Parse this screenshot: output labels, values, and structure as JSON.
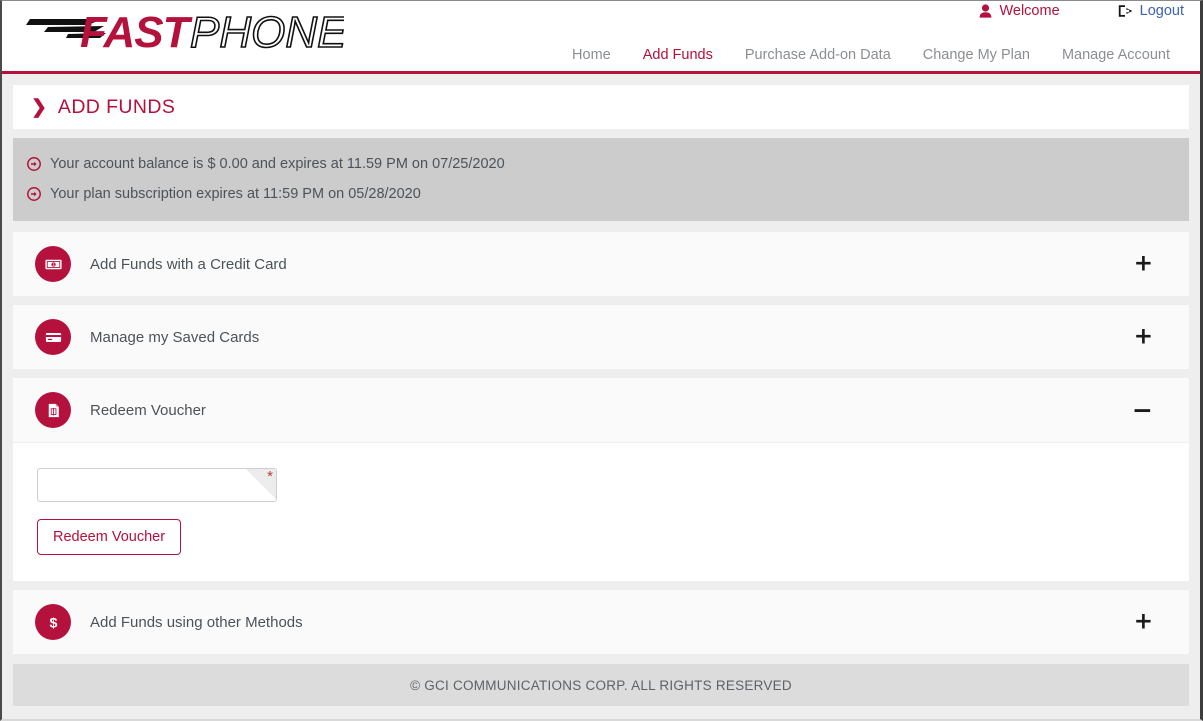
{
  "brand": {
    "logo_primary": "FAST",
    "logo_secondary": "PHONE",
    "accent_color": "#b4113c",
    "link_color": "#3b63b0"
  },
  "header": {
    "account_links": [
      {
        "label": "Welcome",
        "icon": "user-icon",
        "color": "#b4113c"
      },
      {
        "label": "Logout",
        "icon": "logout-icon",
        "color": "#3b63b0"
      }
    ],
    "nav": [
      {
        "label": "Home",
        "active": false
      },
      {
        "label": "Add Funds",
        "active": true
      },
      {
        "label": "Purchase Add-on Data",
        "active": false
      },
      {
        "label": "Change My Plan",
        "active": false
      },
      {
        "label": "Manage Account",
        "active": false
      }
    ]
  },
  "page": {
    "title": "ADD FUNDS",
    "title_icon": "chevron-right-icon",
    "notices": [
      {
        "icon": "arrow-circle-right-icon",
        "text": "Your account balance is $ 0.00 and expires at 11.59 PM on 07/25/2020"
      },
      {
        "icon": "arrow-circle-right-icon",
        "text": "Your plan subscription expires at 11:59 PM on 05/28/2020"
      }
    ]
  },
  "accordion": [
    {
      "label": "Add Funds with a Credit Card",
      "icon": "money-bill-icon",
      "expanded": false,
      "toggle": "+"
    },
    {
      "label": "Manage my Saved Cards",
      "icon": "credit-card-icon",
      "expanded": false,
      "toggle": "+"
    },
    {
      "label": "Redeem Voucher",
      "icon": "voucher-document-icon",
      "expanded": true,
      "toggle": "−"
    },
    {
      "label": "Add Funds using other Methods",
      "icon": "dollar-sign-icon",
      "expanded": false,
      "toggle": "+"
    }
  ],
  "voucher_form": {
    "input_value": "",
    "input_placeholder": "",
    "required_marker": "*",
    "submit_label": "Redeem Voucher"
  },
  "footer": {
    "copyright": "© GCI COMMUNICATIONS CORP. ALL RIGHTS RESERVED"
  }
}
